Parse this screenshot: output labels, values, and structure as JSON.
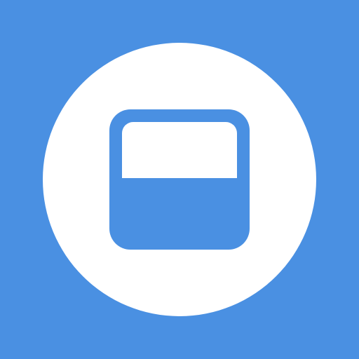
{
  "icon": {
    "name": "app-window-icon",
    "background_color": "#4a90e2",
    "circle_color": "#ffffff",
    "glyph_color": "#4a90e2",
    "glyph_inner_panel_color": "#ffffff"
  }
}
